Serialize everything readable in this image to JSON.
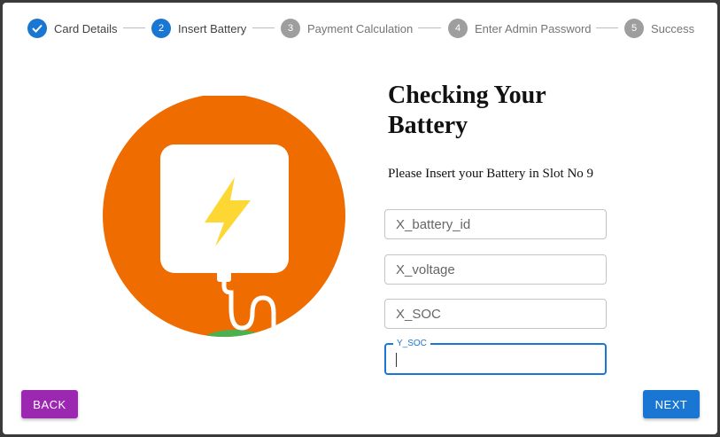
{
  "stepper": {
    "steps": [
      {
        "number": "1",
        "label": "Card Details",
        "state": "done"
      },
      {
        "number": "2",
        "label": "Insert Battery",
        "state": "active"
      },
      {
        "number": "3",
        "label": "Payment Calculation",
        "state": "idle"
      },
      {
        "number": "4",
        "label": "Enter Admin Password",
        "state": "idle"
      },
      {
        "number": "5",
        "label": "Success",
        "state": "idle"
      }
    ]
  },
  "main": {
    "title": "Checking Your Battery",
    "subtitle": "Please Insert your Battery in Slot No 9",
    "illustration_icon": "lightning-bolt-icon",
    "fields": [
      {
        "placeholder": "X_battery_id",
        "value": ""
      },
      {
        "placeholder": "X_voltage",
        "value": ""
      },
      {
        "placeholder": "X_SOC",
        "value": ""
      },
      {
        "label": "Y_SOC",
        "value": "",
        "focused": true
      }
    ]
  },
  "actions": {
    "back_label": "BACK",
    "next_label": "NEXT"
  },
  "colors": {
    "primary": "#1976d2",
    "back_button": "#9c27b0",
    "illustration_bg": "#ef6c00",
    "bolt": "#fdd835",
    "plug_base": "#4caf50"
  }
}
